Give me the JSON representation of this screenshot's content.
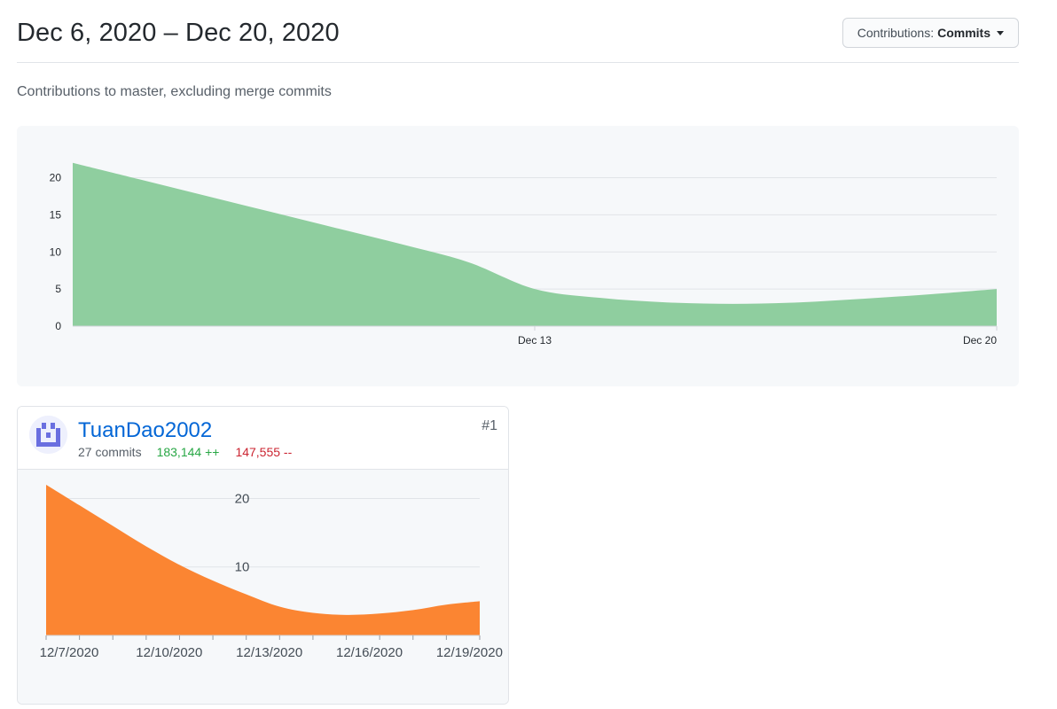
{
  "header": {
    "range_title": "Dec 6, 2020 – Dec 20, 2020",
    "contributions_label": "Contributions:",
    "contributions_value": "Commits"
  },
  "subtitle": "Contributions to master, excluding merge commits",
  "colors": {
    "main_area": "#8fce9f",
    "contributor_area": "#fb8532",
    "username_link": "#0366d6",
    "additions": "#28a745",
    "deletions": "#cb2431"
  },
  "chart_data": [
    {
      "type": "area",
      "x": [
        "Dec 6",
        "Dec 7",
        "Dec 8",
        "Dec 9",
        "Dec 10",
        "Dec 11",
        "Dec 12",
        "Dec 13",
        "Dec 14",
        "Dec 15",
        "Dec 16",
        "Dec 17",
        "Dec 18",
        "Dec 19",
        "Dec 20"
      ],
      "series": [
        {
          "values": [
            22,
            19.8,
            17.6,
            15.4,
            13.2,
            11,
            8.6,
            5,
            3.8,
            3.2,
            3,
            3.2,
            3.7,
            4.3,
            5
          ]
        }
      ],
      "x_tick_labels": [
        "Dec 13",
        "Dec 20"
      ],
      "y_ticks": [
        0,
        5,
        10,
        15,
        20
      ],
      "ylim": [
        0,
        24
      ],
      "grid": true
    },
    {
      "type": "area",
      "x": [
        "12/7/2020",
        "12/8/2020",
        "12/9/2020",
        "12/10/2020",
        "12/11/2020",
        "12/12/2020",
        "12/13/2020",
        "12/14/2020",
        "12/15/2020",
        "12/16/2020",
        "12/17/2020",
        "12/18/2020",
        "12/19/2020",
        "12/20/2020"
      ],
      "series": [
        {
          "values": [
            22,
            19,
            16,
            13,
            10.3,
            8,
            6,
            4.2,
            3.3,
            3,
            3.2,
            3.7,
            4.5,
            5
          ]
        }
      ],
      "x_tick_labels": [
        "12/7/2020",
        "12/10/2020",
        "12/13/2020",
        "12/16/2020",
        "12/19/2020"
      ],
      "y_ticks": [
        10,
        20
      ],
      "ylim": [
        0,
        22
      ],
      "grid": true
    }
  ],
  "contributor": {
    "username": "TuanDao2002",
    "rank": "#1",
    "commits": "27 commits",
    "additions": "183,144 ++",
    "deletions": "147,555 --"
  }
}
